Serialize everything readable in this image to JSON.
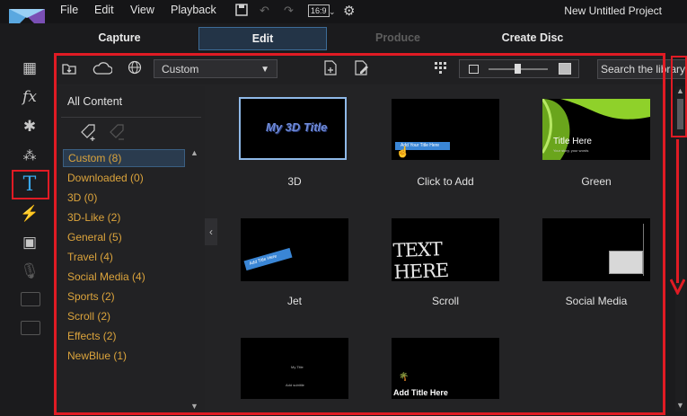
{
  "menu": {
    "file": "File",
    "edit": "Edit",
    "view": "View",
    "playback": "Playback"
  },
  "toolbar": {
    "aspect_ratio": "16:9"
  },
  "project_title": "New Untitled Project",
  "tabs": [
    "Capture",
    "Edit",
    "Produce",
    "Create Disc"
  ],
  "library": {
    "sort_value": "Custom",
    "search_placeholder": "Search the library",
    "category_header": "All Content",
    "categories": [
      "Custom  (8)",
      "Downloaded  (0)",
      "3D  (0)",
      "3D-Like  (2)",
      "General  (5)",
      "Travel  (4)",
      "Social Media  (4)",
      "Sports  (2)",
      "Scroll  (2)",
      "Effects  (2)",
      "NewBlue  (1)"
    ],
    "thumb_labels": [
      "3D",
      "Click to Add",
      "Green",
      "Jet",
      "Scroll",
      "Social Media"
    ],
    "thumb_text": {
      "t3d": "My 3D Title",
      "click_banner": "Add Your Title Here",
      "green_title": "Title Here",
      "green_sub": "Your story, your words",
      "jet_banner": "Add Title Here",
      "scroll": "TEXT HERE",
      "row3b": "Add Title Here",
      "row3a_line1": "My Title",
      "row3a_line2": "Add subtitle"
    }
  },
  "colors": {
    "accent": "#3aa7ea",
    "highlight_box": "#e01b24",
    "category_text": "#dca43c"
  }
}
